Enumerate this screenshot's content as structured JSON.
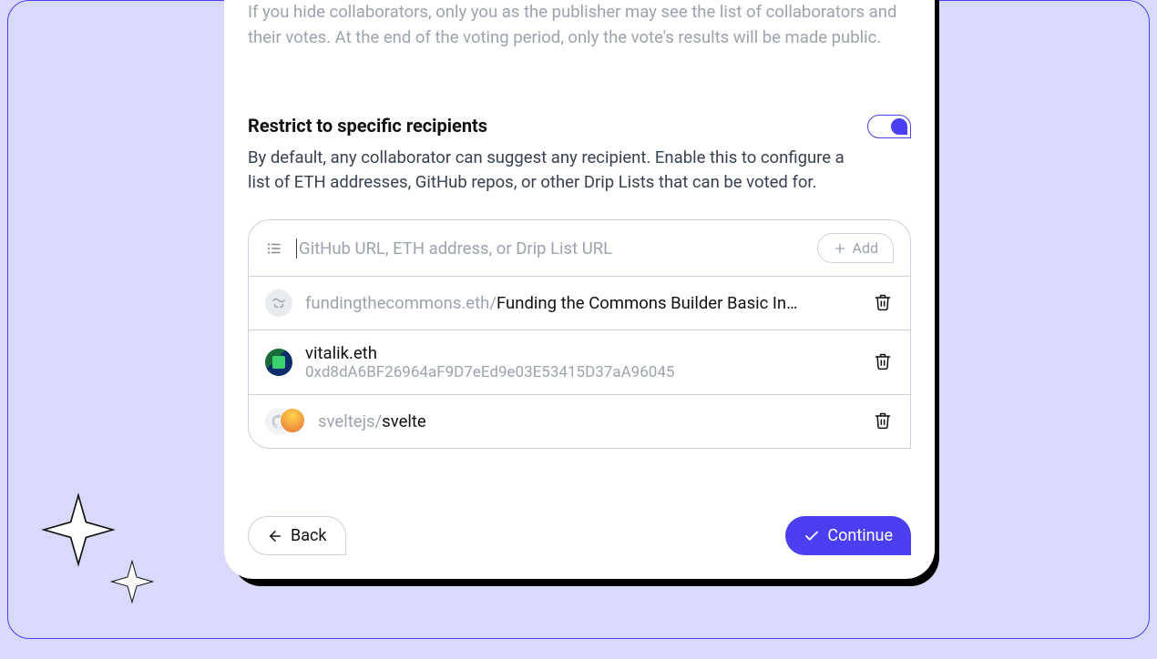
{
  "intro": "If you hide collaborators, only you as the publisher may see the list of collaborators and their votes. At the end of the voting period, only the vote's results will be made public.",
  "restrict": {
    "title": "Restrict to specific recipients",
    "desc": "By default, any collaborator can suggest any recipient. Enable this to configure a list of ETH addresses, GitHub repos, or other Drip Lists that can be voted for.",
    "toggle_on": true
  },
  "input": {
    "placeholder": "GitHub URL, ETH address, or Drip List URL",
    "add_label": "Add"
  },
  "recipients": [
    {
      "prefix": "fundingthecommons.eth/",
      "name": "Funding the Commons Builder Basic In…"
    },
    {
      "title": "vitalik.eth",
      "sub": "0xd8dA6BF26964aF9D7eEd9e03E53415D37aA96045"
    },
    {
      "prefix": "sveltejs/",
      "name": "svelte"
    }
  ],
  "footer": {
    "back": "Back",
    "continue": "Continue"
  }
}
